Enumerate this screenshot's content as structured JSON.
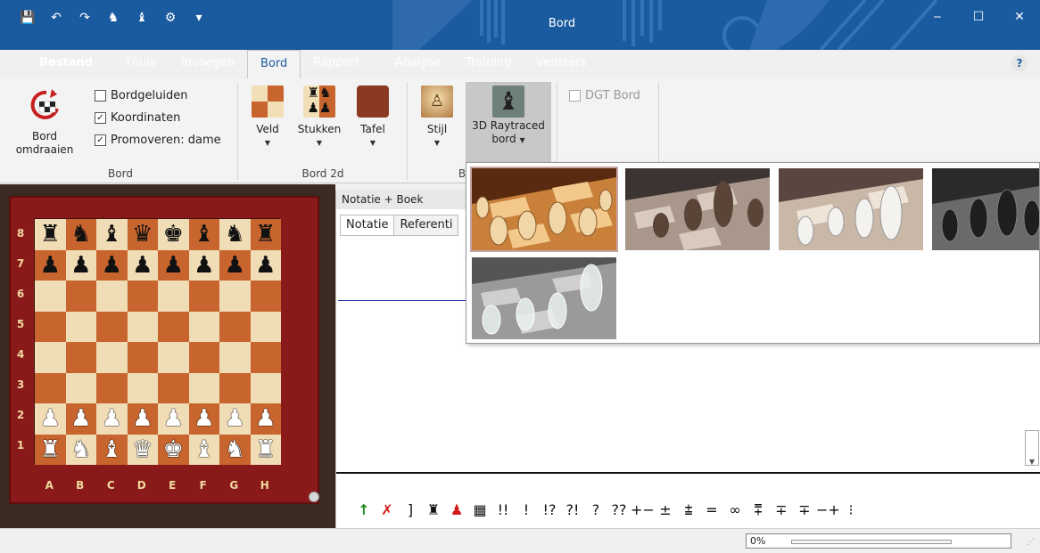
{
  "window": {
    "title": "Bord"
  },
  "qat": [
    "💾",
    "↶",
    "↷",
    "♞",
    "♝",
    "⚙",
    "▾"
  ],
  "window_controls": [
    "‒",
    "☐",
    "✕"
  ],
  "tabs": [
    "Bestand",
    "Thuis",
    "Invoegen",
    "Bord",
    "Rapport",
    "Analyse",
    "Training",
    "Vensters"
  ],
  "help": "?",
  "ribbon": {
    "flip_label": "Bord\nomdraaien",
    "checkboxes": [
      {
        "label": "Bordgeluiden",
        "checked": false
      },
      {
        "label": "Koordinaten",
        "checked": true
      },
      {
        "label": "Promoveren: dame",
        "checked": true
      }
    ],
    "group_bord": "Bord",
    "veld": "Veld",
    "stukken": "Stukken",
    "tafel": "Tafel",
    "group_bord2d": "Bord 2d",
    "stijl": "Stijl",
    "raytraced": "3D Raytraced",
    "raytraced2": "bord",
    "group_b": "B",
    "dgt": "DGT Bord"
  },
  "board": {
    "ranks": [
      "8",
      "7",
      "6",
      "5",
      "4",
      "3",
      "2",
      "1"
    ],
    "files": [
      "A",
      "B",
      "C",
      "D",
      "E",
      "F",
      "G",
      "H"
    ],
    "position": [
      "♜♞♝♛♚♝♞♜",
      "♟♟♟♟♟♟♟♟",
      "        ",
      "        ",
      "        ",
      "        ",
      "♙♙♙♙♙♙♙♙",
      "♖♘♗♕♔♗♘♖"
    ]
  },
  "notation": {
    "title": "Notatie + Boek",
    "tabs": [
      "Notatie",
      "Referenti"
    ]
  },
  "symbols": [
    "↑",
    "✗",
    "]",
    "♜",
    "♟",
    "▦",
    "!!",
    "!",
    "!?",
    "?!",
    "?",
    "??",
    "+−",
    "±",
    "⩲",
    "=",
    "∞",
    "⩱",
    "∓",
    "∓",
    "−+",
    "⁝"
  ],
  "status": {
    "progress_text": "0%",
    "progress": 0.0
  }
}
